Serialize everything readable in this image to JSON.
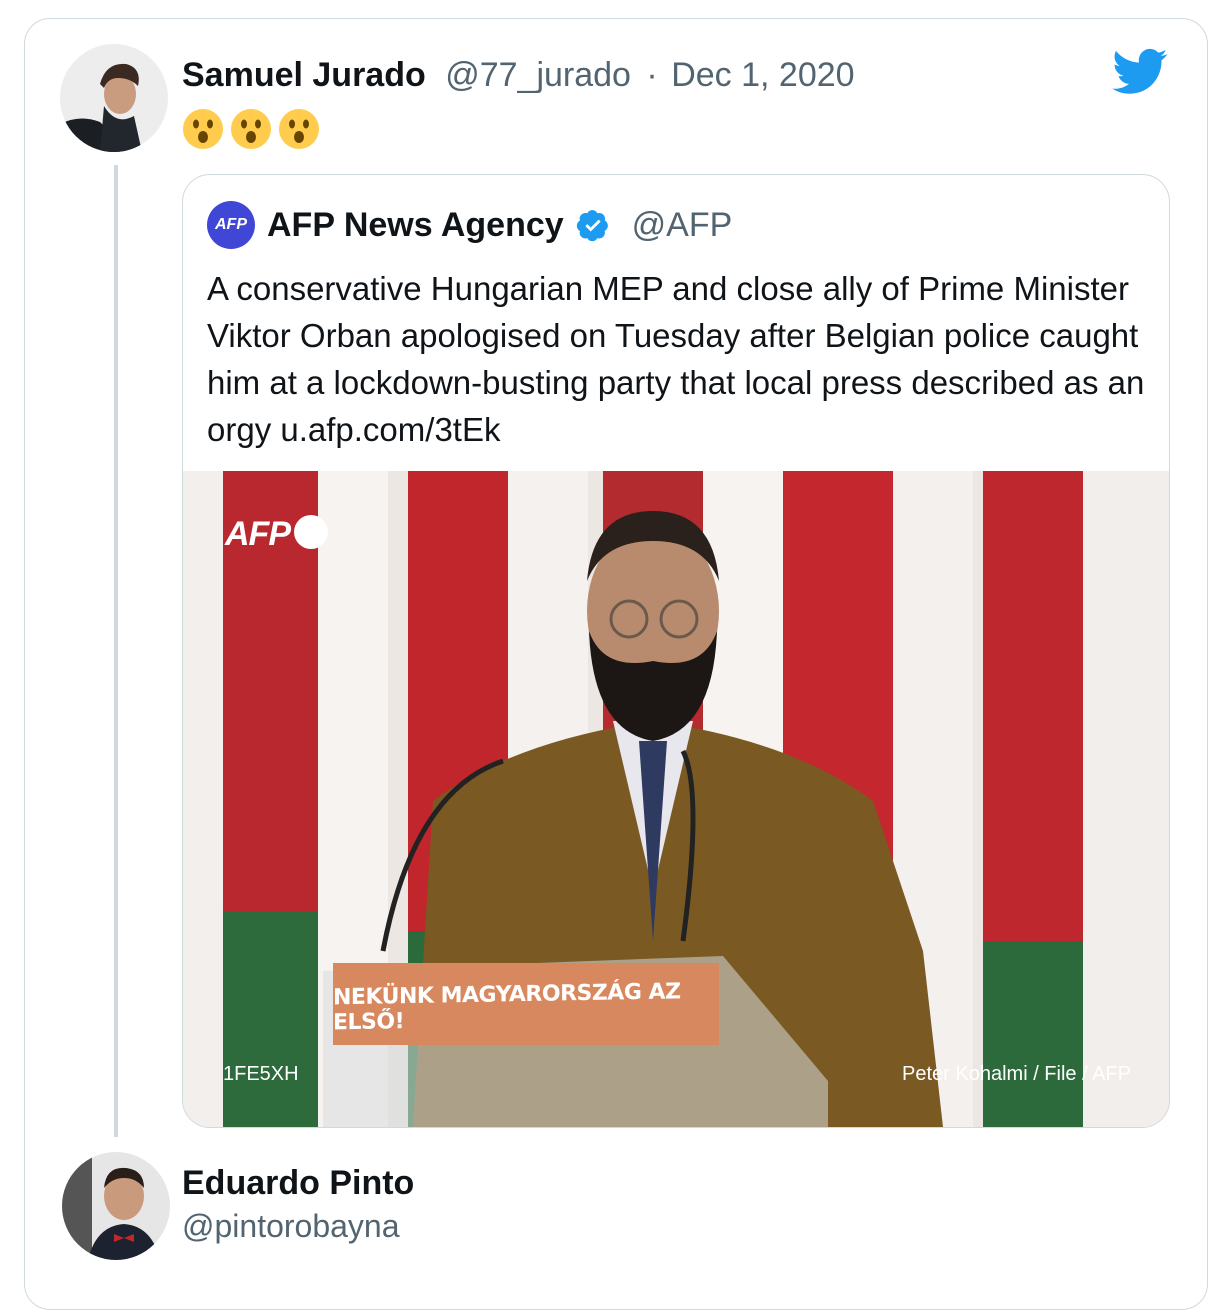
{
  "tweet": {
    "author_name": "Samuel Jurado",
    "author_handle": "@77_jurado",
    "separator": "·",
    "date": "Dec 1, 2020",
    "emoji_text": "😮😮😮"
  },
  "quoted": {
    "logo_text": "AFP",
    "author_name": "AFP News Agency",
    "verified": true,
    "author_handle": "@AFP",
    "text": "A conservative Hungarian MEP and close ally of Prime Minister Viktor Orban apologised on Tuesday after Belgian police caught him at a lockdown-busting party that local press described as an orgy u.afp.com/3tEk",
    "photo": {
      "watermark": "AFP",
      "podium_text": "NEKÜNK MAGYARORSZÁG AZ ELSŐ!",
      "code": "1FE5XH",
      "credit": "Peter Kohalmi / File / AFP"
    }
  },
  "reply": {
    "author_name": "Eduardo Pinto",
    "author_handle": "@pintorobayna"
  },
  "icons": {
    "brand": "twitter-bird-icon",
    "verified": "verified-badge-icon"
  },
  "colors": {
    "twitter_blue": "#1d9bf0",
    "muted_text": "#536471",
    "border": "#cfd9de"
  }
}
